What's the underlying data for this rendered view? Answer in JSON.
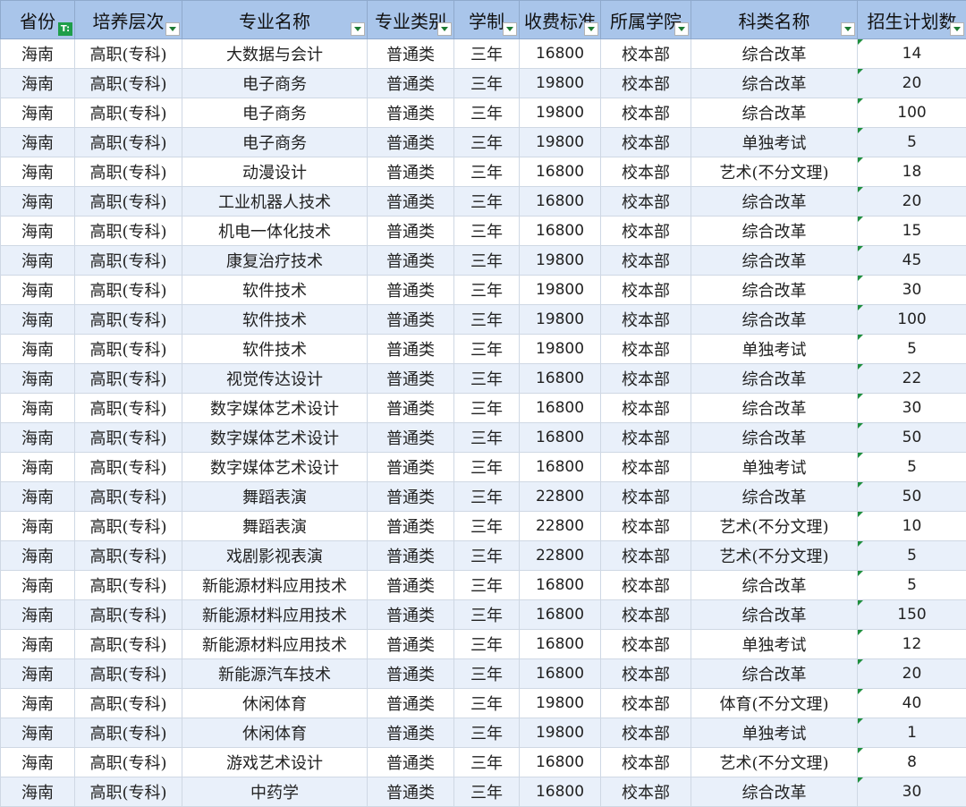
{
  "headers": [
    "省份",
    "培养层次",
    "专业名称",
    "专业类别",
    "学制",
    "收费标准",
    "所属学院",
    "科类名称",
    "招生计划数"
  ],
  "rows": [
    [
      "海南",
      "高职(专科)",
      "大数据与会计",
      "普通类",
      "三年",
      "16800",
      "校本部",
      "综合改革",
      "14"
    ],
    [
      "海南",
      "高职(专科)",
      "电子商务",
      "普通类",
      "三年",
      "19800",
      "校本部",
      "综合改革",
      "20"
    ],
    [
      "海南",
      "高职(专科)",
      "电子商务",
      "普通类",
      "三年",
      "19800",
      "校本部",
      "综合改革",
      "100"
    ],
    [
      "海南",
      "高职(专科)",
      "电子商务",
      "普通类",
      "三年",
      "19800",
      "校本部",
      "单独考试",
      "5"
    ],
    [
      "海南",
      "高职(专科)",
      "动漫设计",
      "普通类",
      "三年",
      "16800",
      "校本部",
      "艺术(不分文理)",
      "18"
    ],
    [
      "海南",
      "高职(专科)",
      "工业机器人技术",
      "普通类",
      "三年",
      "16800",
      "校本部",
      "综合改革",
      "20"
    ],
    [
      "海南",
      "高职(专科)",
      "机电一体化技术",
      "普通类",
      "三年",
      "16800",
      "校本部",
      "综合改革",
      "15"
    ],
    [
      "海南",
      "高职(专科)",
      "康复治疗技术",
      "普通类",
      "三年",
      "19800",
      "校本部",
      "综合改革",
      "45"
    ],
    [
      "海南",
      "高职(专科)",
      "软件技术",
      "普通类",
      "三年",
      "19800",
      "校本部",
      "综合改革",
      "30"
    ],
    [
      "海南",
      "高职(专科)",
      "软件技术",
      "普通类",
      "三年",
      "19800",
      "校本部",
      "综合改革",
      "100"
    ],
    [
      "海南",
      "高职(专科)",
      "软件技术",
      "普通类",
      "三年",
      "19800",
      "校本部",
      "单独考试",
      "5"
    ],
    [
      "海南",
      "高职(专科)",
      "视觉传达设计",
      "普通类",
      "三年",
      "16800",
      "校本部",
      "综合改革",
      "22"
    ],
    [
      "海南",
      "高职(专科)",
      "数字媒体艺术设计",
      "普通类",
      "三年",
      "16800",
      "校本部",
      "综合改革",
      "30"
    ],
    [
      "海南",
      "高职(专科)",
      "数字媒体艺术设计",
      "普通类",
      "三年",
      "16800",
      "校本部",
      "综合改革",
      "50"
    ],
    [
      "海南",
      "高职(专科)",
      "数字媒体艺术设计",
      "普通类",
      "三年",
      "16800",
      "校本部",
      "单独考试",
      "5"
    ],
    [
      "海南",
      "高职(专科)",
      "舞蹈表演",
      "普通类",
      "三年",
      "22800",
      "校本部",
      "综合改革",
      "50"
    ],
    [
      "海南",
      "高职(专科)",
      "舞蹈表演",
      "普通类",
      "三年",
      "22800",
      "校本部",
      "艺术(不分文理)",
      "10"
    ],
    [
      "海南",
      "高职(专科)",
      "戏剧影视表演",
      "普通类",
      "三年",
      "22800",
      "校本部",
      "艺术(不分文理)",
      "5"
    ],
    [
      "海南",
      "高职(专科)",
      "新能源材料应用技术",
      "普通类",
      "三年",
      "16800",
      "校本部",
      "综合改革",
      "5"
    ],
    [
      "海南",
      "高职(专科)",
      "新能源材料应用技术",
      "普通类",
      "三年",
      "16800",
      "校本部",
      "综合改革",
      "150"
    ],
    [
      "海南",
      "高职(专科)",
      "新能源材料应用技术",
      "普通类",
      "三年",
      "16800",
      "校本部",
      "单独考试",
      "12"
    ],
    [
      "海南",
      "高职(专科)",
      "新能源汽车技术",
      "普通类",
      "三年",
      "16800",
      "校本部",
      "综合改革",
      "20"
    ],
    [
      "海南",
      "高职(专科)",
      "休闲体育",
      "普通类",
      "三年",
      "19800",
      "校本部",
      "体育(不分文理)",
      "40"
    ],
    [
      "海南",
      "高职(专科)",
      "休闲体育",
      "普通类",
      "三年",
      "19800",
      "校本部",
      "单独考试",
      "1"
    ],
    [
      "海南",
      "高职(专科)",
      "游戏艺术设计",
      "普通类",
      "三年",
      "16800",
      "校本部",
      "艺术(不分文理)",
      "8"
    ],
    [
      "海南",
      "高职(专科)",
      "中药学",
      "普通类",
      "三年",
      "16800",
      "校本部",
      "综合改革",
      "30"
    ]
  ],
  "filter_icons": {
    "active": "filter-active-icon",
    "dropdown": "dropdown-arrow-icon",
    "active_color": "#1e9e4a",
    "header_bg": "#a9c5ea",
    "row_alt_bg": "#e9f0fa"
  }
}
